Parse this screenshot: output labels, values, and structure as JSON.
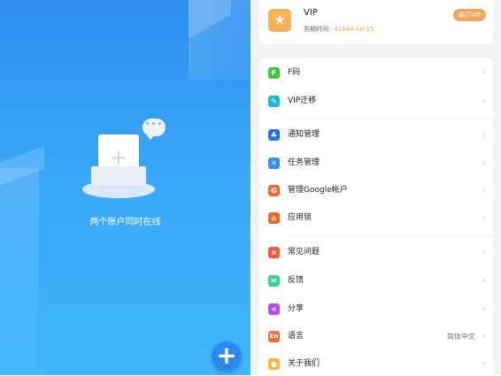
{
  "left_panel": {
    "caption": "两个账户同时在线",
    "fab_symbol": "+",
    "illustration": {
      "plus_symbol": "+",
      "bubble_text": "•••"
    }
  },
  "vip": {
    "icon_symbol": "★",
    "title": "VIP",
    "expiry_label": "到期时间:",
    "expiry_date": "41844-10-15",
    "renew_button": "续订VIP",
    "accent_color": "#f2a65a"
  },
  "menu": {
    "chevron": "›",
    "items": [
      {
        "label": "F码",
        "icon": "f-code-icon",
        "icon_symbol": "F",
        "color": "#3fc53f"
      },
      {
        "label": "VIP迁移",
        "icon": "vip-migrate-icon",
        "icon_symbol": "✎",
        "color": "#20b8d8"
      },
      {
        "label": "通知管理",
        "icon": "bell-icon",
        "icon_symbol": "♣",
        "color": "#2f6fe0"
      },
      {
        "label": "任务管理",
        "icon": "task-icon",
        "icon_symbol": "✕",
        "color": "#2f8ff0"
      },
      {
        "label": "管理Google帐户",
        "icon": "google-icon",
        "icon_symbol": "G",
        "color": "#ef6a3a"
      },
      {
        "label": "应用锁",
        "icon": "lock-icon",
        "icon_symbol": "⌂",
        "color": "#ea6a2c"
      },
      {
        "label": "常见问题",
        "icon": "faq-icon",
        "icon_symbol": "×",
        "color": "#ef5a3c"
      },
      {
        "label": "反馈",
        "icon": "feedback-icon",
        "icon_symbol": "✉",
        "color": "#3fcf8a"
      },
      {
        "label": "分享",
        "icon": "share-icon",
        "icon_symbol": "<",
        "color": "#b24fe0"
      },
      {
        "label": "语言",
        "icon": "language-icon",
        "icon_symbol": "En",
        "color": "#ef6a3a",
        "value": "简体中文"
      },
      {
        "label": "关于我们",
        "icon": "about-icon",
        "icon_symbol": "●",
        "color": "#f5b942"
      }
    ]
  }
}
